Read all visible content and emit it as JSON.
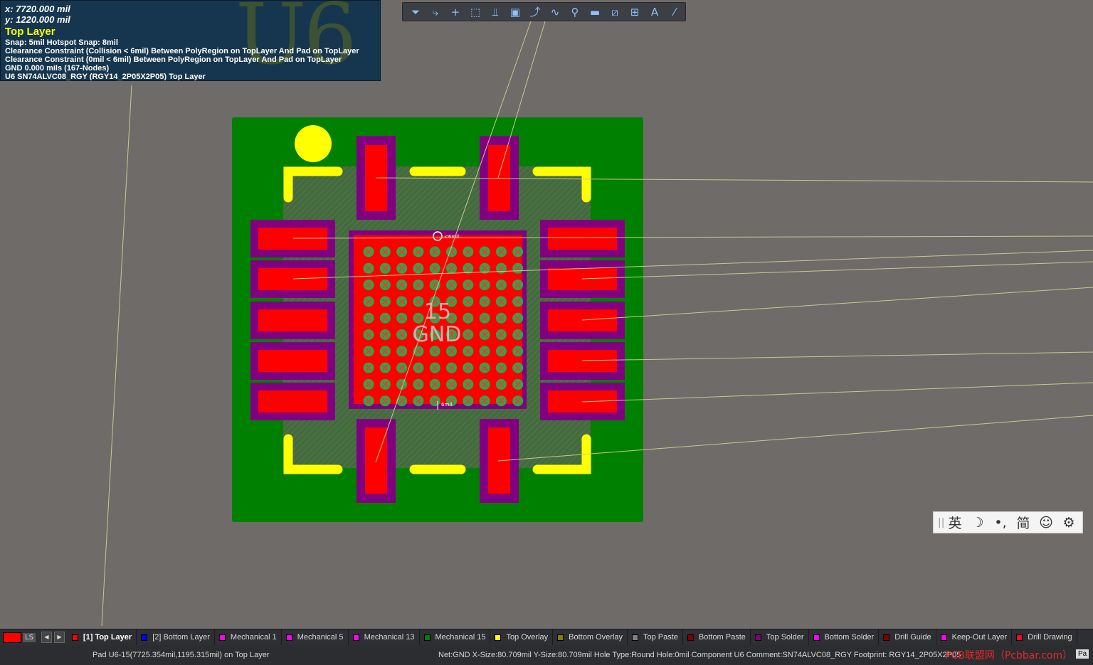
{
  "hud": {
    "x": "x:  7720.000  mil",
    "y": "y:  1220.000  mil",
    "layer": "Top Layer",
    "snap": "Snap: 5mil Hotspot Snap: 8mil",
    "clearance1": "Clearance Constraint (Collision < 6mil)  Between PolyRegion on TopLayer And Pad on TopLayer",
    "clearance2": "Clearance Constraint (0mil < 6mil)  Between PolyRegion on TopLayer And Pad on TopLayer",
    "net": "GND      0.000 mils  (167-Nodes)",
    "component": "U6  SN74ALVC08_RGY (RGY14_2P05X2P05)  Top Layer",
    "watermark": "U6"
  },
  "toolbar": {
    "icons": [
      "filter-icon",
      "select-connected-icon",
      "add-icon",
      "rect-select-icon",
      "align-icon",
      "component-icon",
      "route-icon",
      "diff-pair-icon",
      "via-icon",
      "fill-icon",
      "polygon-icon",
      "dimension-icon",
      "text-icon",
      "line-icon"
    ],
    "glyphs": [
      "⏷",
      "⤷",
      "+",
      "⬚",
      "⫫",
      "▣",
      "⤴",
      "∿",
      "⚲",
      "▬",
      "⧄",
      "⊞",
      "A",
      "⁄"
    ]
  },
  "board": {
    "pad_number": "15",
    "pad_net": "GND",
    "meas_top": "<6mil",
    "meas_bottom": "6mil"
  },
  "ime": {
    "grip": "||",
    "items": [
      "英",
      "☽",
      "•,",
      "简",
      "☺",
      "⚙"
    ]
  },
  "layers": {
    "current_label": "LS",
    "tabs": [
      {
        "label": "[1] Top Layer",
        "color": "#ff0000",
        "active": true
      },
      {
        "label": "[2] Bottom Layer",
        "color": "#0000ff",
        "active": false
      },
      {
        "label": "Mechanical 1",
        "color": "#ff00ff",
        "active": false
      },
      {
        "label": "Mechanical 5",
        "color": "#ff00ff",
        "active": false
      },
      {
        "label": "Mechanical 13",
        "color": "#ff00ff",
        "active": false
      },
      {
        "label": "Mechanical 15",
        "color": "#008000",
        "active": false
      },
      {
        "label": "Top Overlay",
        "color": "#ffff00",
        "active": false
      },
      {
        "label": "Bottom Overlay",
        "color": "#808000",
        "active": false
      },
      {
        "label": "Top Paste",
        "color": "#808080",
        "active": false
      },
      {
        "label": "Bottom Paste",
        "color": "#800000",
        "active": false
      },
      {
        "label": "Top Solder",
        "color": "#800080",
        "active": false
      },
      {
        "label": "Bottom Solder",
        "color": "#ff00ff",
        "active": false
      },
      {
        "label": "Drill Guide",
        "color": "#800000",
        "active": false
      },
      {
        "label": "Keep-Out Layer",
        "color": "#ff00ff",
        "active": false
      },
      {
        "label": "Drill Drawing",
        "color": "#ff0033",
        "active": false
      }
    ]
  },
  "status": {
    "left": "Pad U6-15(7725.354mil,1195.315mil) on Top Layer",
    "right": "Net:GND X-Size:80.709mil Y-Size:80.709mil Hole Type:Round Hole:0mil   Component U6 Comment:SN74ALVC08_RGY Footprint: RGY14_2P05X2P05",
    "watermark": "PCB联盟网（Pcbbar.com）",
    "panel": "Pa"
  },
  "colors": {
    "board_green": "#008000",
    "pad_red": "#ff0000",
    "solder_purple": "#800080",
    "overlay_yellow": "#ffff00",
    "ratsnest": "#c8c890",
    "background": "#6f6b69"
  }
}
